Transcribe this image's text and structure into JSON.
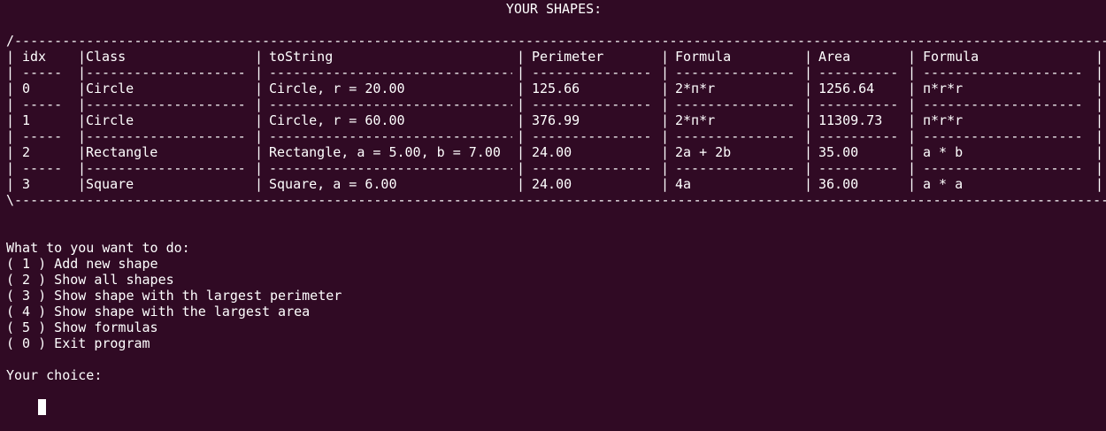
{
  "title": "YOUR SHAPES:",
  "table": {
    "top_border": "/------------------------------------------------------------------------------------------------------------------------------------------\\",
    "bottom_border": "\\------------------------------------------------------------------------------------------------------------------------------------------/",
    "headers": [
      "idx",
      "Class",
      "toString",
      "Perimeter",
      "Formula",
      "Area",
      "Formula"
    ],
    "separators": [
      "-----",
      "--------------------",
      "--------------------------------",
      "---------------",
      "---------------",
      "----------",
      "--------------------"
    ],
    "rows": [
      [
        "0",
        "Circle",
        "Circle, r = 20.00",
        "125.66",
        "2*п*r",
        "1256.64",
        "п*r*r"
      ],
      [
        "1",
        "Circle",
        "Circle, r = 60.00",
        "376.99",
        "2*п*r",
        "11309.73",
        "п*r*r"
      ],
      [
        "2",
        "Rectangle",
        "Rectangle, a = 5.00, b = 7.00",
        "24.00",
        "2a + 2b",
        "35.00",
        "a * b"
      ],
      [
        "3",
        "Square",
        "Square, a = 6.00",
        "24.00",
        "4a",
        "36.00",
        "a * a"
      ]
    ]
  },
  "menu": {
    "prompt": "What to you want to do:",
    "options": [
      "( 1 ) Add new shape",
      "( 2 ) Show all shapes",
      "( 3 ) Show shape with th largest perimeter",
      "( 4 ) Show shape with the largest area",
      "( 5 ) Show formulas",
      "( 0 ) Exit program"
    ]
  },
  "input_prompt": "Your choice:"
}
